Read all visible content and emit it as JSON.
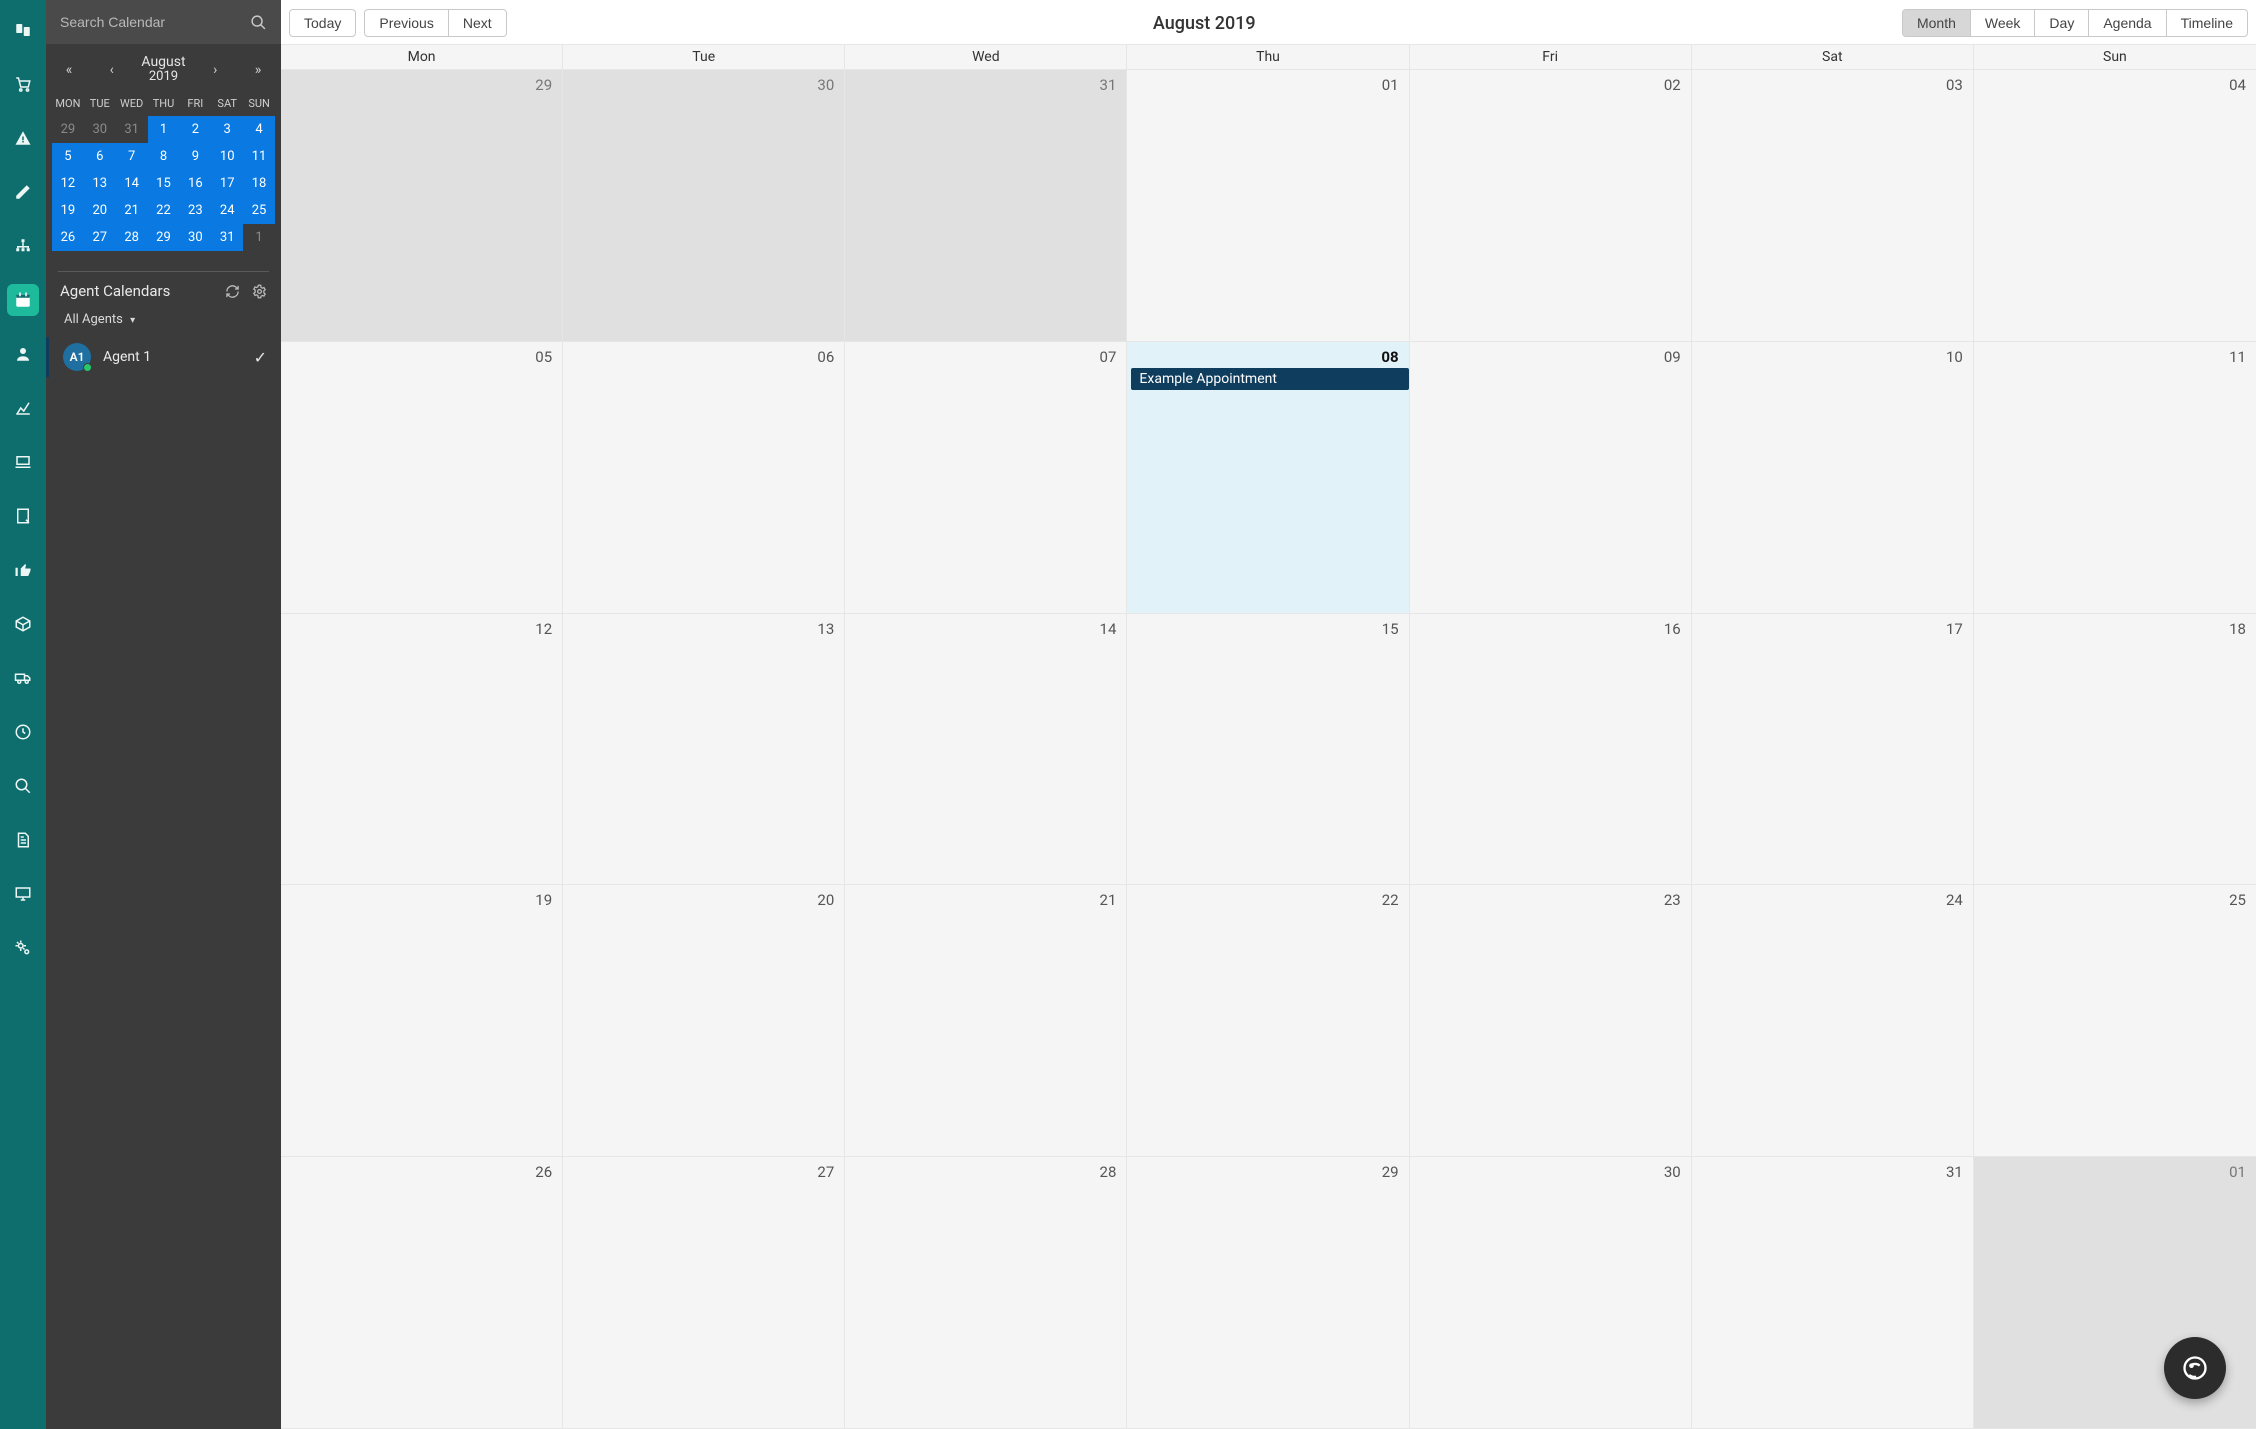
{
  "nav_icons": [
    "cards-icon",
    "cart-icon",
    "alert-icon",
    "edit-icon",
    "tree-icon",
    "calendar-icon",
    "user-icon",
    "chart-icon",
    "laptop-icon",
    "note-icon",
    "thumb-icon",
    "box-icon",
    "truck-icon",
    "clock-icon",
    "search-icon",
    "doc-icon",
    "monitor-icon",
    "gears-icon"
  ],
  "active_nav_index": 5,
  "search": {
    "placeholder": "Search Calendar"
  },
  "mini_cal": {
    "title_month": "August",
    "title_year": "2019",
    "nav": {
      "first": "«",
      "prev": "‹",
      "next": "›",
      "last": "»"
    },
    "dow": [
      "MON",
      "TUE",
      "WED",
      "THU",
      "FRI",
      "SAT",
      "SUN"
    ],
    "days": [
      {
        "n": "29",
        "muted": true
      },
      {
        "n": "30",
        "muted": true
      },
      {
        "n": "31",
        "muted": true
      },
      {
        "n": "1",
        "in": true
      },
      {
        "n": "2",
        "in": true
      },
      {
        "n": "3",
        "in": true
      },
      {
        "n": "4",
        "in": true
      },
      {
        "n": "5",
        "in": true
      },
      {
        "n": "6",
        "in": true
      },
      {
        "n": "7",
        "in": true
      },
      {
        "n": "8",
        "in": true
      },
      {
        "n": "9",
        "in": true
      },
      {
        "n": "10",
        "in": true
      },
      {
        "n": "11",
        "in": true
      },
      {
        "n": "12",
        "in": true
      },
      {
        "n": "13",
        "in": true
      },
      {
        "n": "14",
        "in": true
      },
      {
        "n": "15",
        "in": true
      },
      {
        "n": "16",
        "in": true
      },
      {
        "n": "17",
        "in": true
      },
      {
        "n": "18",
        "in": true
      },
      {
        "n": "19",
        "in": true
      },
      {
        "n": "20",
        "in": true
      },
      {
        "n": "21",
        "in": true
      },
      {
        "n": "22",
        "in": true
      },
      {
        "n": "23",
        "in": true
      },
      {
        "n": "24",
        "in": true
      },
      {
        "n": "25",
        "in": true
      },
      {
        "n": "26",
        "in": true
      },
      {
        "n": "27",
        "in": true
      },
      {
        "n": "28",
        "in": true
      },
      {
        "n": "29",
        "in": true
      },
      {
        "n": "30",
        "in": true
      },
      {
        "n": "31",
        "in": true
      },
      {
        "n": "1",
        "muted": true
      }
    ]
  },
  "agents": {
    "header": "Agent Calendars",
    "filter": "All Agents",
    "list": [
      {
        "initials": "A1",
        "name": "Agent 1",
        "checked": true
      }
    ]
  },
  "toolbar": {
    "today": "Today",
    "previous": "Previous",
    "next": "Next",
    "title": "August 2019",
    "views": [
      "Month",
      "Week",
      "Day",
      "Agenda",
      "Timeline"
    ],
    "active_view": "Month"
  },
  "month": {
    "dow": [
      "Mon",
      "Tue",
      "Wed",
      "Thu",
      "Fri",
      "Sat",
      "Sun"
    ],
    "cells": [
      {
        "n": "29",
        "out": true
      },
      {
        "n": "30",
        "out": true
      },
      {
        "n": "31",
        "out": true
      },
      {
        "n": "01"
      },
      {
        "n": "02"
      },
      {
        "n": "03"
      },
      {
        "n": "04"
      },
      {
        "n": "05"
      },
      {
        "n": "06"
      },
      {
        "n": "07"
      },
      {
        "n": "08",
        "today": true,
        "event": "Example Appointment"
      },
      {
        "n": "09"
      },
      {
        "n": "10"
      },
      {
        "n": "11"
      },
      {
        "n": "12"
      },
      {
        "n": "13"
      },
      {
        "n": "14"
      },
      {
        "n": "15"
      },
      {
        "n": "16"
      },
      {
        "n": "17"
      },
      {
        "n": "18"
      },
      {
        "n": "19"
      },
      {
        "n": "20"
      },
      {
        "n": "21"
      },
      {
        "n": "22"
      },
      {
        "n": "23"
      },
      {
        "n": "24"
      },
      {
        "n": "25"
      },
      {
        "n": "26"
      },
      {
        "n": "27"
      },
      {
        "n": "28"
      },
      {
        "n": "29"
      },
      {
        "n": "30"
      },
      {
        "n": "31"
      },
      {
        "n": "01",
        "out": true
      }
    ]
  },
  "fab": {
    "label": "chat"
  }
}
